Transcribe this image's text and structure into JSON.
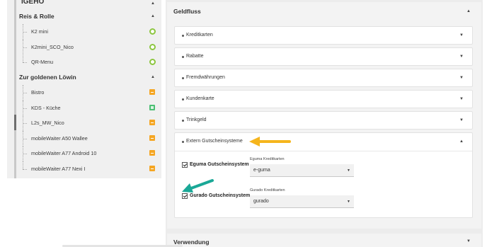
{
  "tree": {
    "root_label": "IGEHO",
    "groups": [
      {
        "label": "Reis & Rolle",
        "items": [
          {
            "label": "K2 mini",
            "status": "ring"
          },
          {
            "label": "K2mini_SCO_Nico",
            "status": "ring"
          },
          {
            "label": "QR-Menu",
            "status": "ring"
          }
        ]
      },
      {
        "label": "Zur goldenen Löwin",
        "items": [
          {
            "label": "Bistro",
            "status": "orange"
          },
          {
            "label": "KDS - Küche",
            "status": "green"
          },
          {
            "label": "L2s_MW_Nico",
            "status": "orange"
          },
          {
            "label": "mobileWaiter A50 Wallee",
            "status": "orange"
          },
          {
            "label": "mobileWaiter A77 Android 10",
            "status": "orange"
          },
          {
            "label": "mobileWaiter A77 Nexi I",
            "status": "orange"
          }
        ]
      }
    ]
  },
  "geldfluss": {
    "title": "Geldfluss",
    "sections": [
      {
        "label": "Kreditkarten"
      },
      {
        "label": "Rabatte"
      },
      {
        "label": "Fremdwährungen"
      },
      {
        "label": "Kundenkarte"
      },
      {
        "label": "Trinkgeld"
      },
      {
        "label": "Extern Gutscheinsysteme"
      }
    ],
    "extern": {
      "eguma": {
        "checkbox_label": "Eguma Gutscheinsystem",
        "field_label": "Eguma Kreditkarten",
        "value": "e-guma"
      },
      "gurado": {
        "checkbox_label": "Gurado Gutscheinsystem",
        "field_label": "Gurado Kreditkarten",
        "value": "gurado"
      }
    }
  },
  "verwendung": {
    "title": "Verwendung"
  },
  "colors": {
    "arrow_orange": "#f5b51d",
    "arrow_teal": "#1aa897",
    "status_ring": "#8cc63f",
    "status_orange": "#f5a623",
    "status_green": "#4bbf73"
  },
  "icons": {
    "expanded": "chevron-up-icon",
    "collapsed": "chevron-down-icon"
  }
}
